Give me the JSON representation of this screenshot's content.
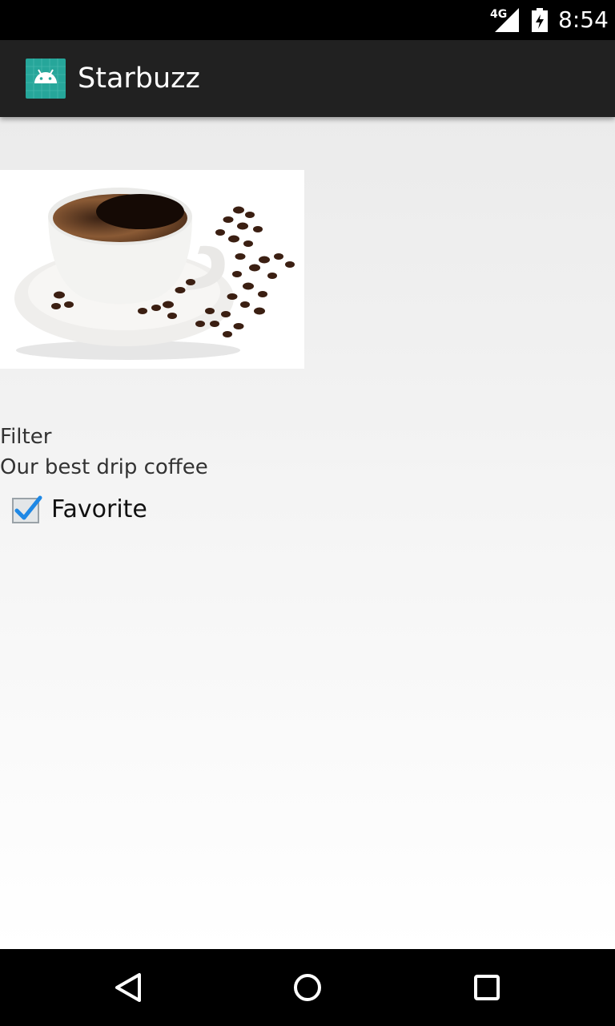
{
  "status_bar": {
    "network": "4G",
    "time": "8:54"
  },
  "app_bar": {
    "title": "Starbuzz",
    "icon": "android-icon"
  },
  "drink": {
    "image": "coffee-cup-image",
    "name": "Filter",
    "description": "Our best drip coffee",
    "favorite_label": "Favorite",
    "favorite_checked": true
  },
  "nav_bar": {
    "back": "back-icon",
    "home": "home-icon",
    "recents": "recents-icon"
  },
  "colors": {
    "accent": "#1e88e5",
    "app_icon_bg": "#26a69a",
    "action_bar": "#212121"
  }
}
